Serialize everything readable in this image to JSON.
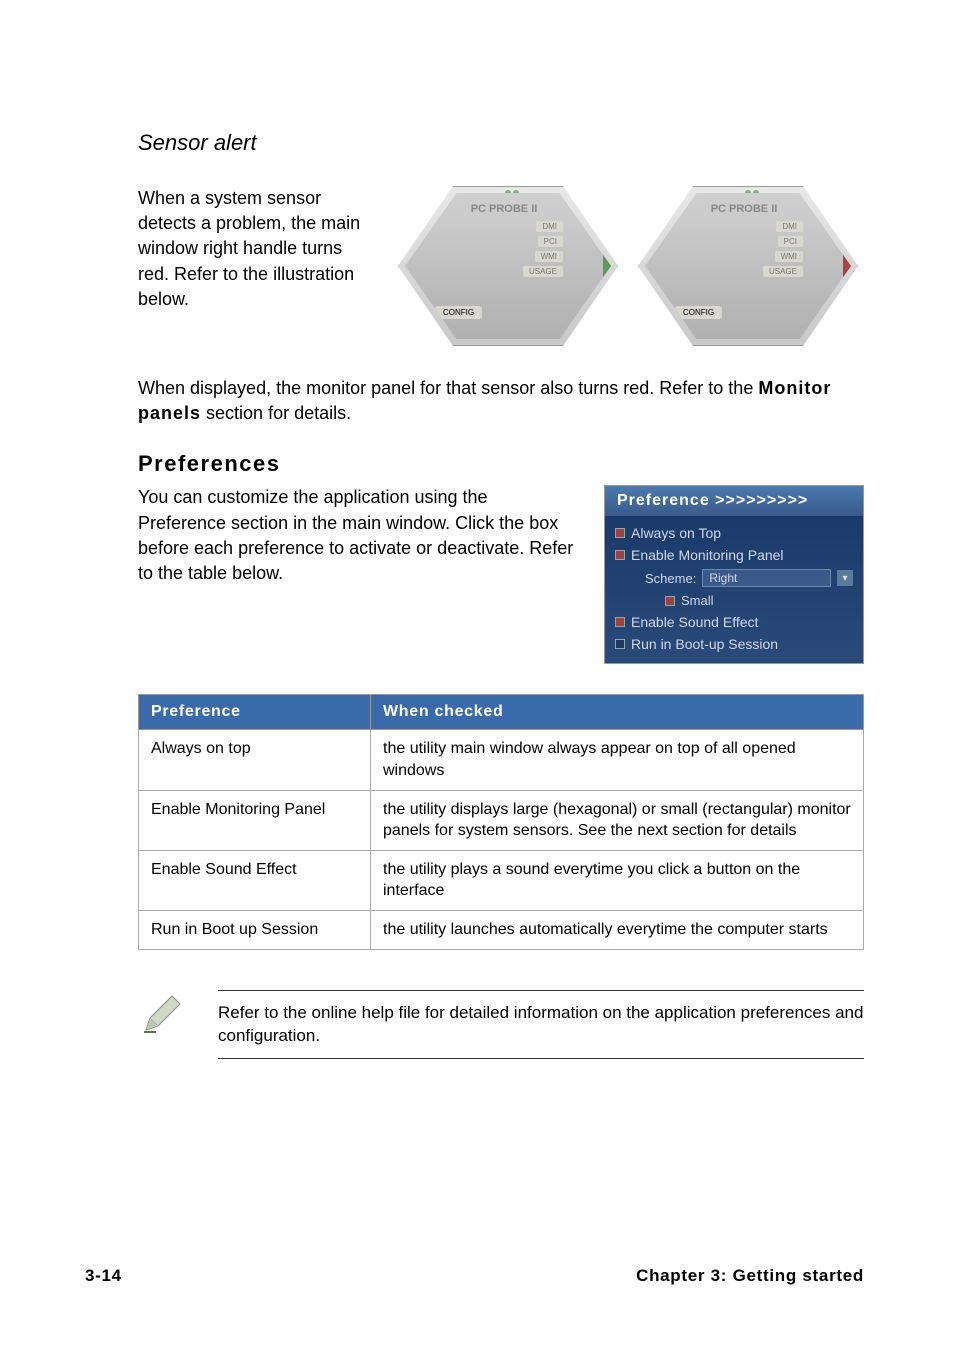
{
  "sensor_alert": {
    "title": "Sensor alert",
    "paragraph1": "When a system sensor detects a problem, the main window right handle turns red. Refer to the illustration below.",
    "paragraph2_prefix": "When displayed, the monitor panel for that sensor also turns red. Refer to the ",
    "monitor_panels_bold": "Monitor panels",
    "paragraph2_suffix": " section for details."
  },
  "hexagon": {
    "title": "PC PROBE II",
    "labels": [
      "DMI",
      "PCI",
      "WMI",
      "USAGE"
    ],
    "bottom": "CONFIG"
  },
  "preferences": {
    "heading": "Preferences",
    "intro": "You can customize the application using the Preference section in the main window. Click the box before each preference to activate or deactivate. Refer to the table below.",
    "panel_header": "Preference >>>>>>>>>",
    "items": [
      {
        "label": "Always on Top",
        "checked": true
      },
      {
        "label": "Enable Monitoring Panel",
        "checked": true
      }
    ],
    "scheme_label": "Scheme:",
    "scheme_value": "Right",
    "small_label": "Small",
    "sound_label": "Enable Sound Effect",
    "boot_label": "Run in Boot-up Session"
  },
  "table": {
    "headers": {
      "col1": "Preference",
      "col2": "When checked"
    },
    "rows": [
      {
        "pref": "Always on top",
        "desc": "the utility main window always appear on top of all opened windows"
      },
      {
        "pref": "Enable Monitoring Panel",
        "desc": "the utility displays large (hexagonal) or small (rectangular) monitor panels for system sensors. See the next section for details"
      },
      {
        "pref": "Enable Sound Effect",
        "desc": "the utility plays a sound everytime you click a button on the interface"
      },
      {
        "pref": "Run in Boot up Session",
        "desc": "the utility launches automatically everytime the computer starts"
      }
    ]
  },
  "note": "Refer to the online help file for detailed information on the application preferences and configuration.",
  "footer": {
    "left": "3-14",
    "right": "Chapter 3: Getting started"
  }
}
